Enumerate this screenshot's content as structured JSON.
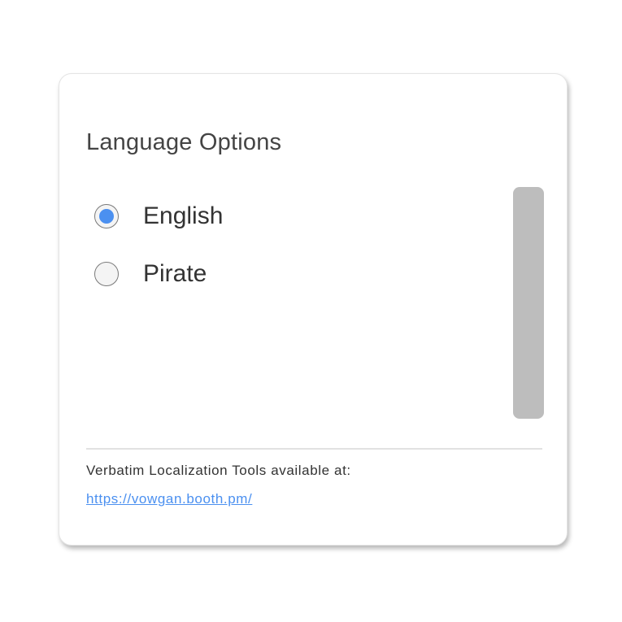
{
  "panel": {
    "title": "Language Options",
    "options": [
      {
        "label": "English",
        "selected": true
      },
      {
        "label": "Pirate",
        "selected": false
      }
    ],
    "footer_text": "Verbatim Localization Tools available at:",
    "footer_link": "https://vowgan.booth.pm/"
  },
  "colors": {
    "accent": "#4b90f0",
    "scrollbar": "#bdbdbd",
    "text": "#333333",
    "title": "#444444"
  }
}
